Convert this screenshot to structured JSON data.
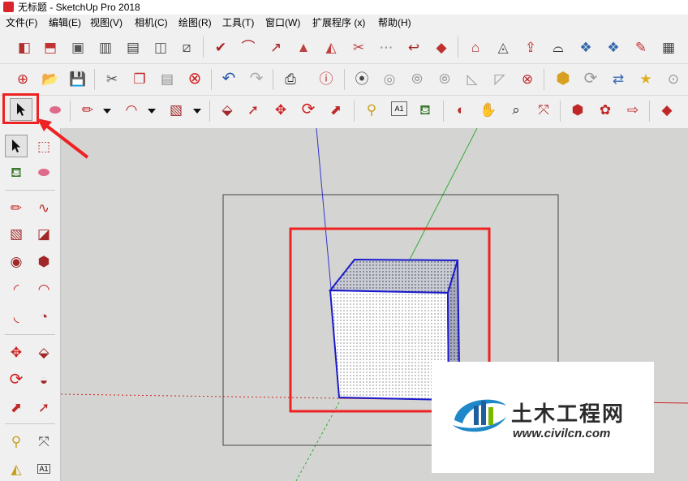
{
  "window": {
    "title": "无标题 - SketchUp Pro 2018"
  },
  "menu": {
    "items": [
      {
        "label": "文件(F)"
      },
      {
        "label": "编辑(E)"
      },
      {
        "label": "视图(V)"
      },
      {
        "label": "相机(C)"
      },
      {
        "label": "绘图(R)"
      },
      {
        "label": "工具(T)"
      },
      {
        "label": "窗口(W)"
      },
      {
        "label": "扩展程序 (x)"
      },
      {
        "label": "帮助(H)"
      }
    ]
  },
  "toolbar_row1": {
    "icons": [
      "section-cube-icon",
      "push-section-icon",
      "box-view-icon",
      "fence-icon",
      "rail-icon",
      "book-icon",
      "roof-icon",
      "vertex-select-icon",
      "arc-tool-icon",
      "curve-tool-icon",
      "mountain-icon",
      "unfold-icon",
      "cut-icon",
      "node-chain-icon",
      "reverse-icon",
      "tag-icon",
      "house-icon",
      "triangle-icon",
      "upload-icon",
      "arc-swap-icon",
      "cubes-icon",
      "edit-window-icon",
      "layers-icon"
    ]
  },
  "toolbar_row2": {
    "icons": [
      "new-model-icon",
      "open-folder-icon",
      "save-icon",
      "scissors-icon",
      "copy-icon",
      "paste-icon",
      "delete-icon",
      "undo-icon",
      "redo-icon",
      "print-icon",
      "model-info-icon",
      "camera-record-icon",
      "disc-icon",
      "film-icon",
      "film-alt-icon",
      "shade-icon",
      "shade-alt-icon",
      "stop-icon",
      "shield-icon",
      "refresh-icon",
      "export-icon",
      "spotlight-icon",
      "photo-icon"
    ]
  },
  "toolbar_row3": {
    "icons": [
      "select-arrow-icon",
      "eraser-icon",
      "pencil-icon",
      "arc-icon",
      "rectangle-icon",
      "push-pull-icon",
      "follow-me-icon",
      "move-icon",
      "rotate-icon",
      "scale-icon",
      "tape-measure-icon",
      "text-label-icon",
      "paint-bucket-icon",
      "orbit-icon",
      "pan-hand-icon",
      "zoom-icon",
      "zoom-extents-icon",
      "warehouse-icon",
      "components-icon",
      "share-icon",
      "ruby-icon"
    ]
  },
  "left_toolbar": {
    "icons": [
      "select-icon",
      "component-icon",
      "paint-icon",
      "eraser-icon",
      "line-icon",
      "freehand-icon",
      "rectangle-icon",
      "rotated-rectangle-icon",
      "circle-icon",
      "polygon-icon",
      "arc-icon",
      "two-point-arc-icon",
      "three-point-arc-icon",
      "pie-icon",
      "move-icon",
      "push-pull-icon",
      "rotate-icon",
      "follow-me-icon",
      "scale-icon",
      "offset-icon",
      "tape-measure-icon",
      "dimension-icon",
      "protractor-icon",
      "text-icon"
    ],
    "text_label": "A1"
  },
  "toolbar_text": {
    "label_a1": "A1"
  },
  "watermark": {
    "brand": "土木工程网",
    "url": "www.civilcn.com",
    "accent_blue": "#1e88c8",
    "accent_green": "#7ab800"
  },
  "colors": {
    "viewport_bg": "#d4d5d2",
    "highlight_red": "#ee2222",
    "axis_blue": "#3333cc",
    "axis_green": "#33aa33",
    "axis_red": "#cc2222",
    "edge_blue": "#1a1acc"
  }
}
